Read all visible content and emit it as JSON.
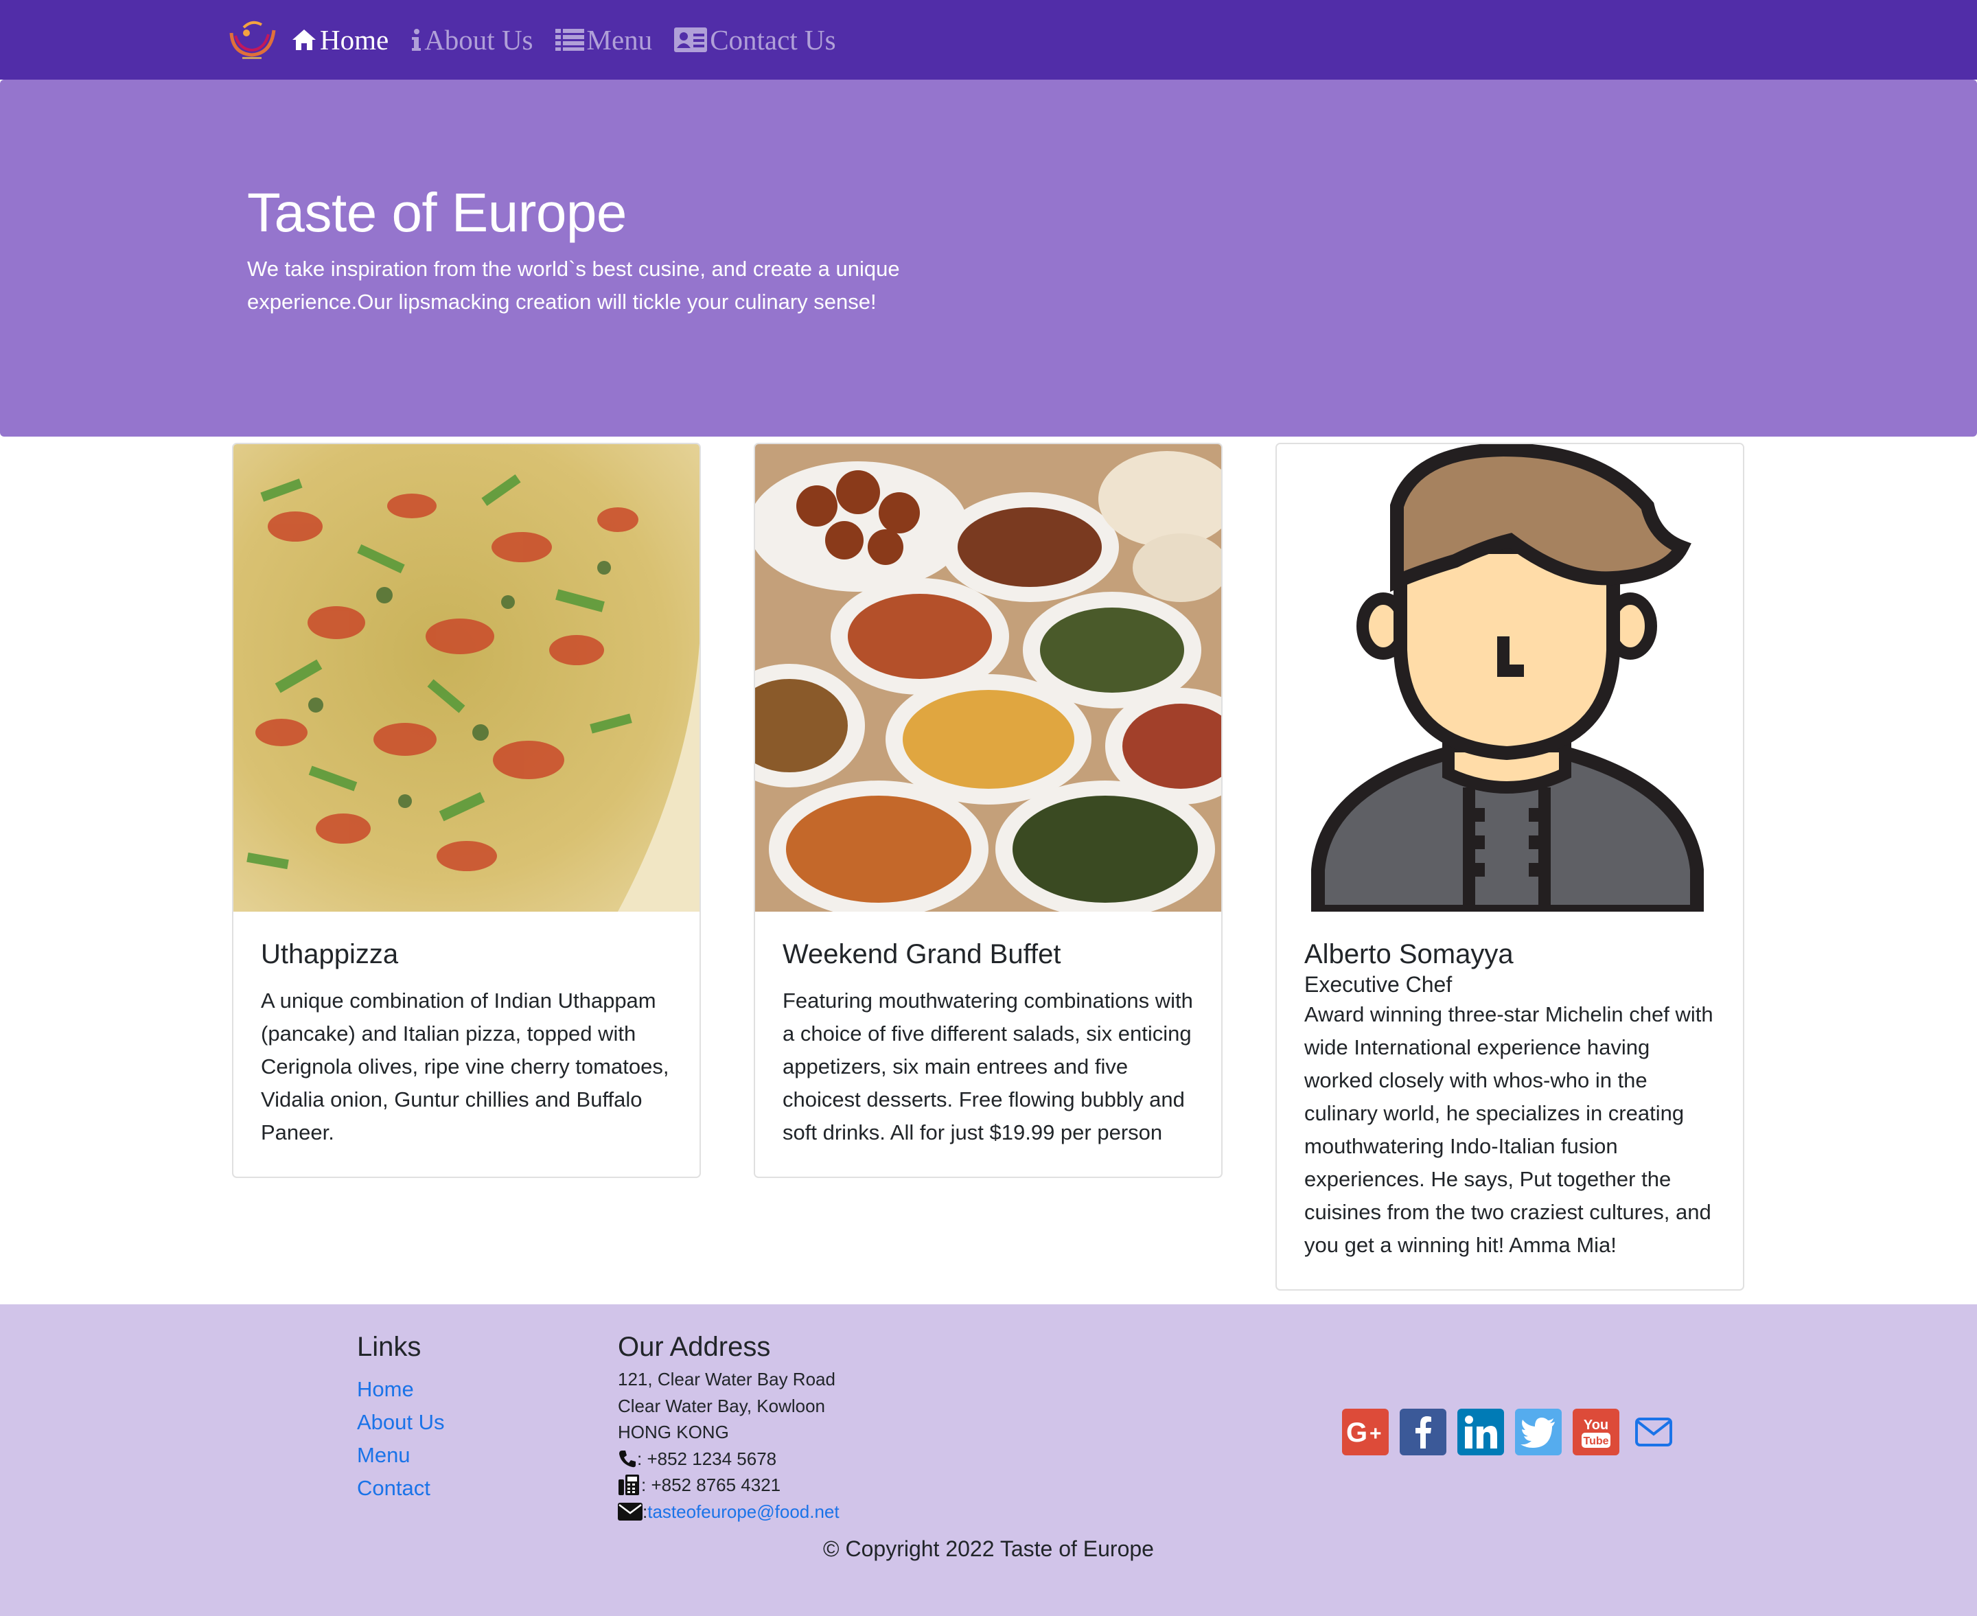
{
  "navbar": {
    "logo_alt": "Taste of Europe logo",
    "items": [
      {
        "label": "Home",
        "icon": "home-icon",
        "active": true
      },
      {
        "label": "About Us",
        "icon": "info-icon",
        "active": false
      },
      {
        "label": "Menu",
        "icon": "list-icon",
        "active": false
      },
      {
        "label": "Contact Us",
        "icon": "address-card-icon",
        "active": false
      }
    ]
  },
  "jumbotron": {
    "title": "Taste of Europe",
    "text": "We take inspiration from the world`s best cusine, and create a unique experience.Our lipsmacking creation will tickle your culinary sense!"
  },
  "cards": [
    {
      "image": "pizza-photo",
      "title": "Uthappizza",
      "subtitle": "",
      "text": "A unique combination of Indian Uthappam (pancake) and Italian pizza, topped with Cerignola olives, ripe vine cherry tomatoes, Vidalia onion, Guntur chillies and Buffalo Paneer."
    },
    {
      "image": "buffet-photo",
      "title": "Weekend Grand Buffet",
      "subtitle": "",
      "text": "Featuring mouthwatering combinations with a choice of five different salads, six enticing appetizers, six main entrees and five choicest desserts. Free flowing bubbly and soft drinks. All for just $19.99 per person"
    },
    {
      "image": "chef-avatar",
      "title": "Alberto Somayya",
      "subtitle": "Executive Chef",
      "text": "Award winning three-star Michelin chef with wide International experience having worked closely with whos-who in the culinary world, he specializes in creating mouthwatering Indo-Italian fusion experiences. He says, Put together the cuisines from the two craziest cultures, and you get a winning hit! Amma Mia!"
    }
  ],
  "footer": {
    "links_title": "Links",
    "links": [
      "Home",
      "About Us",
      "Menu",
      "Contact"
    ],
    "address_title": "Our Address",
    "address_lines": [
      "121, Clear Water Bay Road",
      "Clear Water Bay, Kowloon",
      "HONG KONG"
    ],
    "phone": ": +852 1234 5678",
    "fax": ": +852 8765 4321",
    "email_prefix": ":",
    "email": "tasteofeurope@food.net",
    "social": [
      {
        "icon": "google-plus-icon",
        "color": "#dd4b39"
      },
      {
        "icon": "facebook-icon",
        "color": "#3b5998"
      },
      {
        "icon": "linkedin-icon",
        "color": "#007bb6"
      },
      {
        "icon": "twitter-icon",
        "color": "#55acee"
      },
      {
        "icon": "youtube-icon",
        "color": "#dd4b39"
      },
      {
        "icon": "mail-icon",
        "color": "#1a73e8"
      }
    ],
    "copyright": "© Copyright 2022 Taste of Europe"
  },
  "colors": {
    "navbar": "#512da8",
    "jumbotron": "#9575cd",
    "footer": "#d1c4e9",
    "link": "#1a73e8"
  }
}
